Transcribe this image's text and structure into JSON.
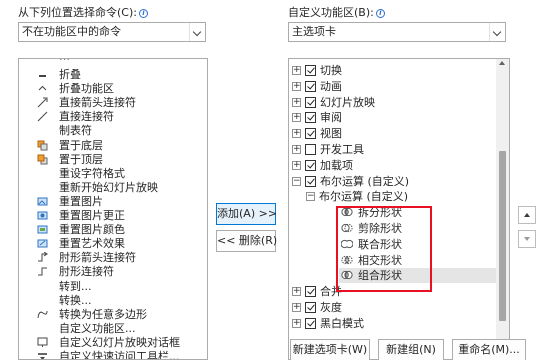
{
  "left": {
    "header": "从下列位置选择命令(C):",
    "combo_value": "不在功能区中的命令",
    "items": [
      {
        "label": "折叠",
        "icon": "collapse-icon"
      },
      {
        "label": "折叠功能区",
        "icon": "caret-up-icon"
      },
      {
        "label": "直接箭头连接符",
        "icon": "arrow-connector-icon"
      },
      {
        "label": "直接连接符",
        "icon": "line-connector-icon"
      },
      {
        "label": "制表符",
        "icon": ""
      },
      {
        "label": "置于底层",
        "icon": "send-to-back-icon"
      },
      {
        "label": "置于顶层",
        "icon": "bring-to-front-icon"
      },
      {
        "label": "重设字符格式",
        "icon": ""
      },
      {
        "label": "重新开始幻灯片放映",
        "icon": ""
      },
      {
        "label": "重置图片",
        "icon": "reset-picture-icon"
      },
      {
        "label": "重置图片更正",
        "icon": "reset-picture-corrections-icon"
      },
      {
        "label": "重置图片颜色",
        "icon": "reset-picture-color-icon"
      },
      {
        "label": "重置艺术效果",
        "icon": "reset-artistic-effects-icon"
      },
      {
        "label": "肘形箭头连接符",
        "icon": "elbow-arrow-connector-icon"
      },
      {
        "label": "肘形连接符",
        "icon": "elbow-connector-icon"
      },
      {
        "label": "转到...",
        "icon": ""
      },
      {
        "label": "转换...",
        "icon": ""
      },
      {
        "label": "转换为任意多边形",
        "icon": "freeform-icon"
      },
      {
        "label": "自定义功能区...",
        "icon": ""
      },
      {
        "label": "自定义幻灯片放映对话框",
        "icon": "custom-slideshow-icon"
      },
      {
        "label": "自定义快速访问工具栏...",
        "icon": "customize-qat-icon"
      }
    ]
  },
  "right": {
    "header": "自定义功能区(B):",
    "combo_value": "主选项卡",
    "items": [
      {
        "label": "切换",
        "checked": true,
        "level": 0
      },
      {
        "label": "动画",
        "checked": true,
        "level": 0
      },
      {
        "label": "幻灯片放映",
        "checked": true,
        "level": 0
      },
      {
        "label": "审阅",
        "checked": true,
        "level": 0
      },
      {
        "label": "视图",
        "checked": true,
        "level": 0
      },
      {
        "label": "开发工具",
        "checked": false,
        "level": 0
      },
      {
        "label": "加载项",
        "checked": true,
        "level": 0
      },
      {
        "label": "布尔运算 (自定义)",
        "checked": true,
        "level": 0,
        "expanded": true
      },
      {
        "label": "布尔运算 (自定义)",
        "level": 1
      },
      {
        "label": "拆分形状",
        "level": 2,
        "icon": "fragment-shapes-icon"
      },
      {
        "label": "剪除形状",
        "level": 2,
        "icon": "subtract-shapes-icon"
      },
      {
        "label": "联合形状",
        "level": 2,
        "icon": "union-shapes-icon"
      },
      {
        "label": "相交形状",
        "level": 2,
        "icon": "intersect-shapes-icon"
      },
      {
        "label": "组合形状",
        "level": 2,
        "icon": "combine-shapes-icon",
        "selected": true
      },
      {
        "label": "合并",
        "checked": true,
        "level": 0
      },
      {
        "label": "灰度",
        "checked": true,
        "level": 0
      },
      {
        "label": "黑白模式",
        "checked": true,
        "level": 0
      }
    ]
  },
  "buttons": {
    "add": "添加(A) >>",
    "remove": "<< 删除(R)",
    "new_tab": "新建选项卡(W)",
    "new_group": "新建组(N)",
    "rename": "重命名(M)..."
  }
}
